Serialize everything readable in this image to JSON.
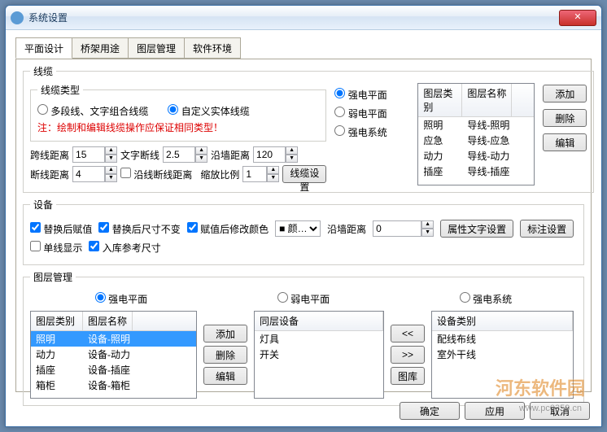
{
  "window": {
    "title": "系统设置"
  },
  "tabs": [
    "平面设计",
    "桥架用途",
    "图层管理",
    "软件环境"
  ],
  "xianlan": {
    "legend": "线缆",
    "type_legend": "线缆类型",
    "type_opt1": "多段线、文字组合线缆",
    "type_opt2": "自定义实体线缆",
    "note": "注：绘制和编辑线缆操作应保证相同类型！",
    "kuaxian_lbl": "跨线距离",
    "kuaxian_val": "15",
    "wenziduan_lbl": "文字断线",
    "wenziduan_val": "2.5",
    "yanqiang_lbl": "沿墙距离",
    "yanqiang_val": "120",
    "duanxian_lbl": "断线距离",
    "duanxian_val": "4",
    "yanxianduan_chk": "沿线断线距离",
    "suofang_lbl": "缩放比例",
    "suofang_val": "1",
    "setbtn": "线缆设置",
    "midradios": [
      "强电平面",
      "弱电平面",
      "强电系统"
    ],
    "tbl_hd1": "图层类别",
    "tbl_hd2": "图层名称",
    "tbl_rows": [
      {
        "a": "照明",
        "b": "导线-照明"
      },
      {
        "a": "应急",
        "b": "导线-应急"
      },
      {
        "a": "动力",
        "b": "导线-动力"
      },
      {
        "a": "插座",
        "b": "导线-插座"
      }
    ],
    "addbtn": "添加",
    "delbtn": "删除",
    "editbtn": "编辑"
  },
  "shebei": {
    "legend": "设备",
    "chk1": "替换后赋值",
    "chk2": "替换后尺寸不变",
    "chk3": "赋值后修改颜色",
    "colorsel": "颜…",
    "yanqiang_lbl": "沿墙距离",
    "yanqiang_val": "0",
    "btn1": "属性文字设置",
    "btn2": "标注设置",
    "chk4": "单线显示",
    "chk5": "入库参考尺寸"
  },
  "tuceng": {
    "legend": "图层管理",
    "radios": [
      "强电平面",
      "弱电平面",
      "强电系统"
    ],
    "col1_hd1": "图层类别",
    "col1_hd2": "图层名称",
    "col1_rows": [
      {
        "a": "照明",
        "b": "设备-照明",
        "sel": true
      },
      {
        "a": "动力",
        "b": "设备-动力"
      },
      {
        "a": "插座",
        "b": "设备-插座"
      },
      {
        "a": "箱柜",
        "b": "设备-箱柜"
      }
    ],
    "addbtn": "添加",
    "delbtn": "删除",
    "editbtn": "编辑",
    "col2_hd": "同层设备",
    "col2_rows": [
      "灯具",
      "开关"
    ],
    "movel": "《",
    "mover": "》",
    "tuku": "图库",
    "col3_hd": "设备类别",
    "col3_rows": [
      "配线布线",
      "室外干线"
    ]
  },
  "dlg": {
    "ok": "确定",
    "apply": "应用",
    "cancel": "取消"
  },
  "watermark": {
    "brand": "河东软件园",
    "url": "www.pc0359.cn"
  }
}
